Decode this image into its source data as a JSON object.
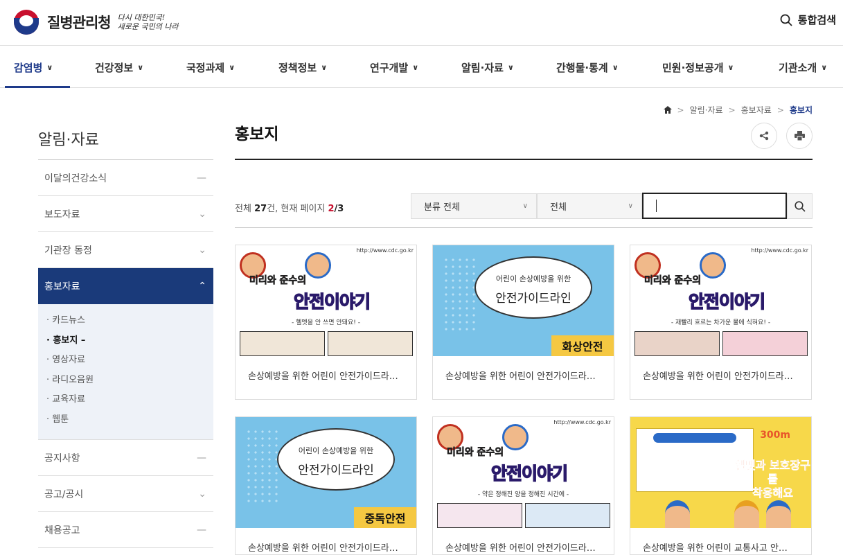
{
  "header": {
    "agency_name": "질병관리청",
    "slogan_line1": "다시 대한민국!",
    "slogan_line2": "새로운 국민의 나라",
    "search_label": "통합검색"
  },
  "gnb": [
    {
      "label": "감염병"
    },
    {
      "label": "건강정보"
    },
    {
      "label": "국정과제"
    },
    {
      "label": "정책정보"
    },
    {
      "label": "연구개발"
    },
    {
      "label": "알림·자료"
    },
    {
      "label": "간행물·통계"
    },
    {
      "label": "민원·정보공개"
    },
    {
      "label": "기관소개"
    }
  ],
  "sidebar": {
    "title": "알림·자료",
    "items": [
      {
        "label": "이달의건강소식",
        "symbol": "—"
      },
      {
        "label": "보도자료",
        "symbol": "⌄"
      },
      {
        "label": "기관장 동정",
        "symbol": "⌄"
      },
      {
        "label": "홍보자료",
        "symbol": "⌃"
      },
      {
        "label": "공지사항",
        "symbol": "—"
      },
      {
        "label": "공고/공시",
        "symbol": "⌄"
      },
      {
        "label": "채용공고",
        "symbol": "—"
      }
    ],
    "subitems": [
      "· 카드뉴스",
      "· 홍보지 –",
      "· 영상자료",
      "· 라디오음원",
      "· 교육자료",
      "· 웹툰"
    ]
  },
  "breadcrumb": [
    "알림·자료",
    "홍보자료",
    "홍보지"
  ],
  "page_title": "홍보지",
  "count": {
    "prefix": "전체 ",
    "total": "27",
    "middle": "건, 현재 페이지 ",
    "page": "2",
    "pages": "/3"
  },
  "filters": {
    "category": "분류 전체",
    "scope": "전체",
    "search_value": ""
  },
  "cards": [
    {
      "caption": "손상예방을 위한 어린이 안전가이드라…",
      "url": "http://www.cdc.go.kr",
      "title": "안전이야기",
      "title_top": "미리와 준수의",
      "sub": "- 헬멧을 안 쓰면 안돼요! -"
    },
    {
      "caption": "손상예방을 위한 어린이 안전가이드라…",
      "bubble1": "어린이 손상예방을 위한",
      "bubble2": "안전가이드라인",
      "band": "화상안전"
    },
    {
      "caption": "손상예방을 위한 어린이 안전가이드라…",
      "url": "http://www.cdc.go.kr",
      "title": "안전이야기",
      "title_top": "미리와 준수의",
      "sub": "- 재빨리 흐르는 차가운 물에 식혀요! -"
    },
    {
      "caption": "손상예방을 위한 어린이 안전가이드라…",
      "bubble1": "어린이 손상예방을 위한",
      "bubble2": "안전가이드라인",
      "band": "중독안전"
    },
    {
      "caption": "손상예방을 위한 어린이 안전가이드라…",
      "url": "http://www.cdc.go.kr",
      "title": "안전이야기",
      "title_top": "미리와 준수의",
      "sub": "- 약은 정해진 양을 정해진 시간에 -"
    },
    {
      "caption": "손상예방을 위한 어린이 교통사고 안…",
      "heading": "헬멧과 보호장구를",
      "heading2": "착용해요",
      "number": "300m"
    }
  ]
}
